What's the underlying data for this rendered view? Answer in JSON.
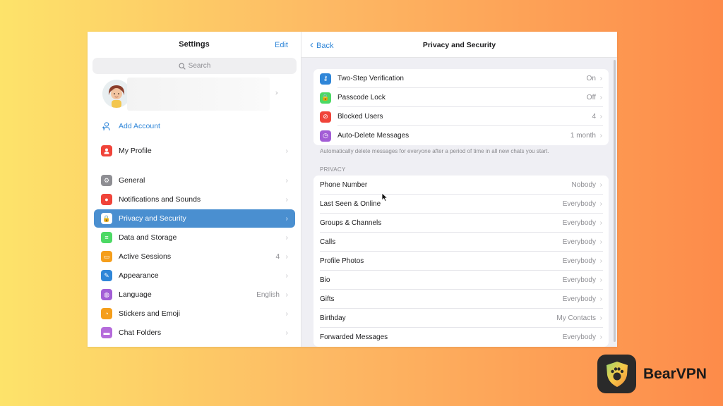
{
  "left_panel": {
    "title": "Settings",
    "edit_label": "Edit",
    "search_placeholder": "Search",
    "add_account_label": "Add Account",
    "my_profile_label": "My Profile",
    "menu": [
      {
        "label": "General",
        "icon": "gear-icon",
        "color": "#8e8e93",
        "value": ""
      },
      {
        "label": "Notifications and Sounds",
        "icon": "bell-icon",
        "color": "#f0443a",
        "value": ""
      },
      {
        "label": "Privacy and Security",
        "icon": "lock-icon",
        "color": "#8e8e93",
        "value": "",
        "active": true
      },
      {
        "label": "Data and Storage",
        "icon": "database-icon",
        "color": "#4cd964",
        "value": ""
      },
      {
        "label": "Active Sessions",
        "icon": "laptop-icon",
        "color": "#f59e1b",
        "value": "4"
      },
      {
        "label": "Appearance",
        "icon": "brush-icon",
        "color": "#2f86d8",
        "value": ""
      },
      {
        "label": "Language",
        "icon": "globe-icon",
        "color": "#a35ed6",
        "value": "English"
      },
      {
        "label": "Stickers and Emoji",
        "icon": "sticker-icon",
        "color": "#f59e1b",
        "value": ""
      },
      {
        "label": "Chat Folders",
        "icon": "folder-icon",
        "color": "#b56bdb",
        "value": ""
      }
    ]
  },
  "right_panel": {
    "back_label": "Back",
    "title": "Privacy and Security",
    "security_rows": [
      {
        "label": "Two-Step Verification",
        "value": "On",
        "icon": "key-icon",
        "color": "#2f86d8"
      },
      {
        "label": "Passcode Lock",
        "value": "Off",
        "icon": "lock-icon",
        "color": "#4cd964"
      },
      {
        "label": "Blocked Users",
        "value": "4",
        "icon": "block-icon",
        "color": "#f0443a"
      },
      {
        "label": "Auto-Delete Messages",
        "value": "1 month",
        "icon": "timer-icon",
        "color": "#a35ed6"
      }
    ],
    "auto_delete_note": "Automatically delete messages for everyone after a period of time in all new chats you start.",
    "privacy_section_title": "PRIVACY",
    "privacy_rows": [
      {
        "label": "Phone Number",
        "value": "Nobody"
      },
      {
        "label": "Last Seen & Online",
        "value": "Everybody"
      },
      {
        "label": "Groups & Channels",
        "value": "Everybody"
      },
      {
        "label": "Calls",
        "value": "Everybody"
      },
      {
        "label": "Profile Photos",
        "value": "Everybody"
      },
      {
        "label": "Bio",
        "value": "Everybody"
      },
      {
        "label": "Gifts",
        "value": "Everybody"
      },
      {
        "label": "Birthday",
        "value": "My Contacts"
      },
      {
        "label": "Forwarded Messages",
        "value": "Everybody"
      }
    ]
  },
  "brand": {
    "name": "BearVPN"
  }
}
